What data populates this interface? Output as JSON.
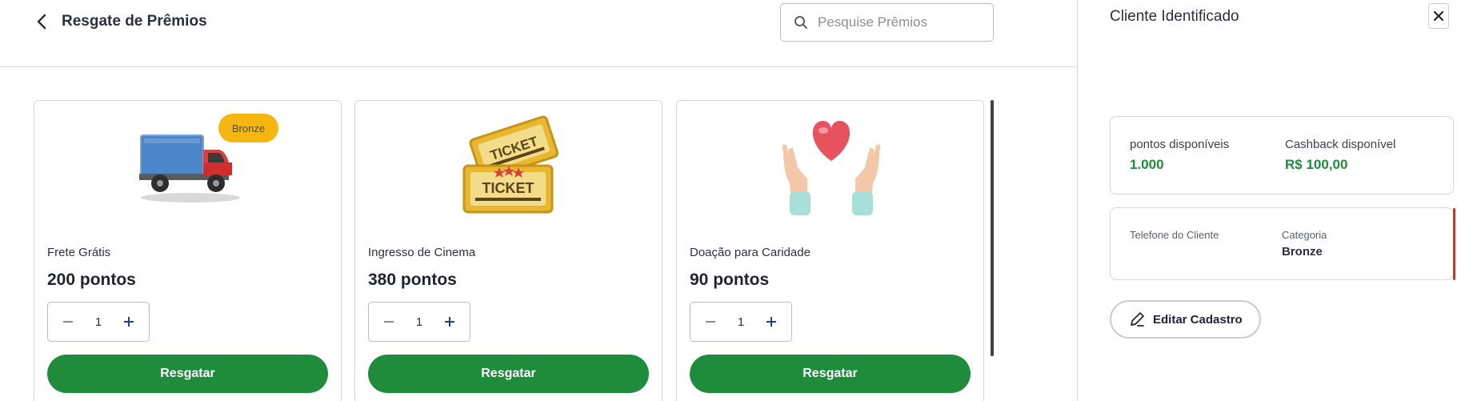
{
  "header": {
    "title": "Resgate de Prêmios",
    "search_placeholder": "Pesquise Prêmios"
  },
  "products": [
    {
      "name": "Frete Grátis",
      "points": "200 pontos",
      "quantity": "1",
      "button": "Resgatar",
      "badge": "Bronze",
      "image": "truck-image"
    },
    {
      "name": "Ingresso de Cinema",
      "points": "380 pontos",
      "quantity": "1",
      "button": "Resgatar",
      "image": "cinema-tickets-image"
    },
    {
      "name": "Doação para Caridade",
      "points": "90 pontos",
      "quantity": "1",
      "button": "Resgatar",
      "image": "charity-heart-hands-image"
    }
  ],
  "ticket_text": "TICKET",
  "panel": {
    "title": "Cliente Identificado",
    "points_label": "pontos disponíveis",
    "points_value": "1.000",
    "cashback_label": "Cashback disponível",
    "cashback_value": "R$ 100,00",
    "phone_label": "Telefone do Cliente",
    "category_label": "Categoria",
    "category_value": "Bronze",
    "edit_label": "Editar Cadastro"
  },
  "colors": {
    "primary_green": "#1f8c3b",
    "badge_gold": "#f5b60f",
    "stepper_blue": "#1b3fa6"
  }
}
